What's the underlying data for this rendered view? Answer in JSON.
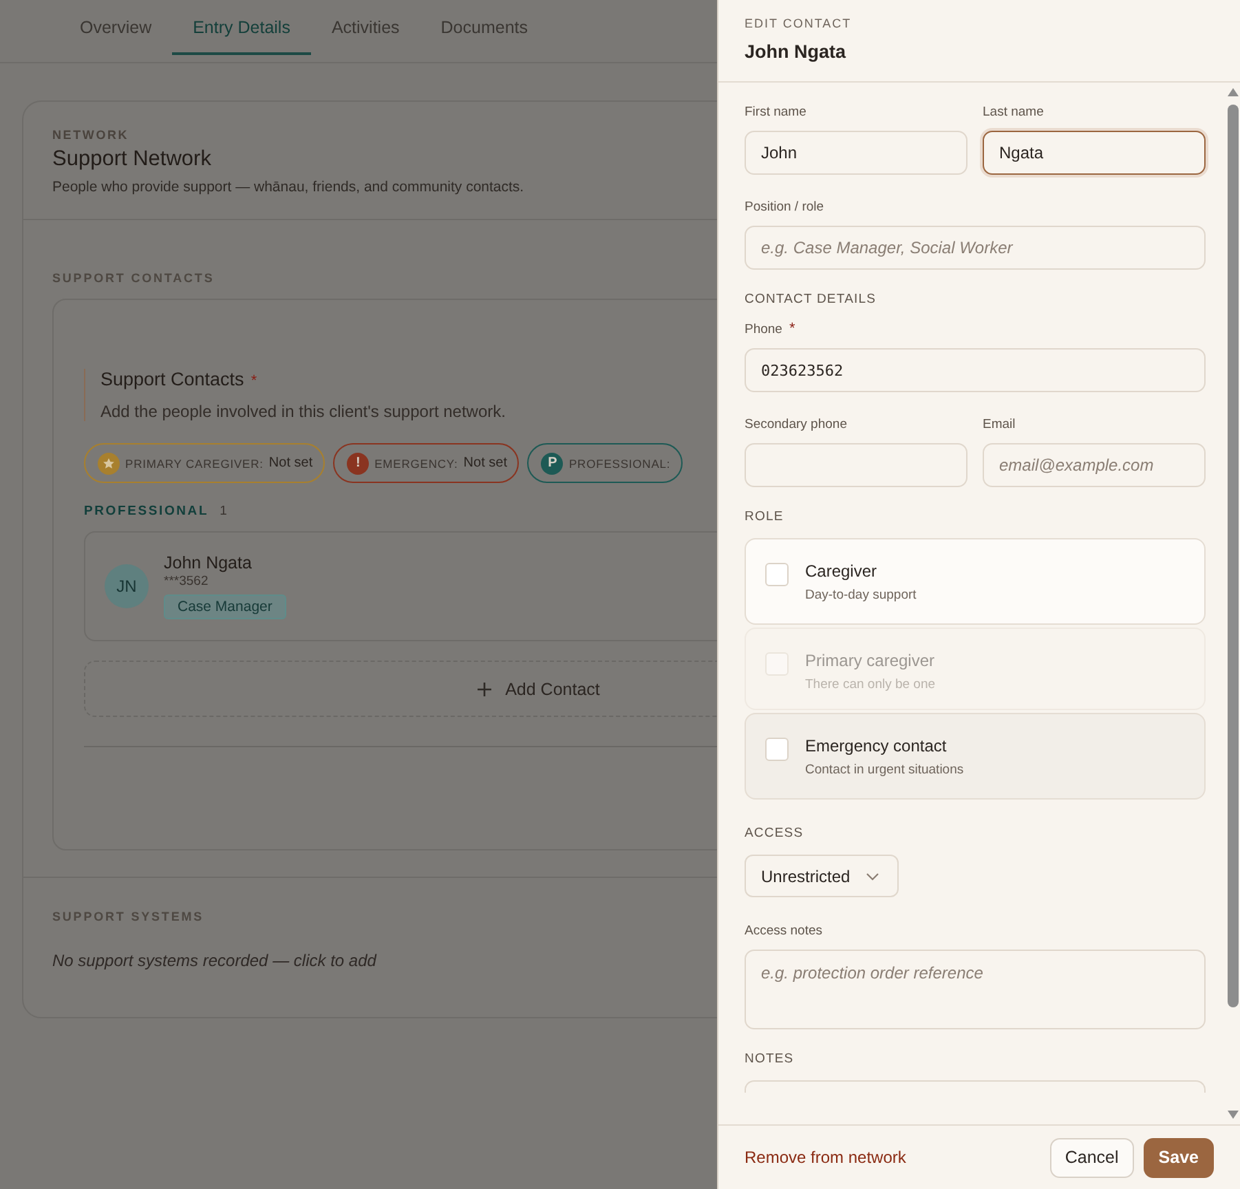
{
  "tabs": [
    {
      "label": "Overview",
      "selected": false
    },
    {
      "label": "Entry Details",
      "selected": true
    },
    {
      "label": "Activities",
      "selected": false
    },
    {
      "label": "Documents",
      "selected": false
    }
  ],
  "network": {
    "eyebrow": "NETWORK",
    "title": "Support Network",
    "description": "People who provide support — whānau, friends, and community contacts."
  },
  "support_contacts": {
    "section_label": "SUPPORT CONTACTS",
    "title": "Support Contacts",
    "required_mark": "*",
    "description": "Add the people involved in this client's support network.",
    "summary_chips": [
      {
        "kind": "star",
        "label": "PRIMARY CAREGIVER:",
        "value": "Not set",
        "color": "#a8802e"
      },
      {
        "kind": "letter",
        "icon_text": "!",
        "label": "EMERGENCY:",
        "value": "Not set",
        "color": "#8a3420"
      },
      {
        "kind": "letter",
        "icon_text": "P",
        "label": "PROFESSIONAL:",
        "color": "#1d5a55"
      }
    ],
    "groups": [
      {
        "title": "PROFESSIONAL",
        "count": "1",
        "contacts": [
          {
            "initials": "JN",
            "name": "John Ngata",
            "phone": "***3562",
            "tags": [
              "Case Manager"
            ]
          }
        ]
      }
    ],
    "add_button": "Add Contact"
  },
  "support_systems": {
    "section_label": "SUPPORT SYSTEMS",
    "empty_text": "No support systems recorded — click to add"
  },
  "drawer": {
    "eyebrow": "EDIT CONTACT",
    "title": "John Ngata",
    "name_fields": [
      {
        "label": "First name",
        "value": "John",
        "focused": false
      },
      {
        "label": "Last name",
        "value": "Ngata",
        "focused": true
      }
    ],
    "position": {
      "label": "Position / role",
      "placeholder": "e.g. Case Manager, Social Worker"
    },
    "contact_details": {
      "heading": "CONTACT DETAILS",
      "phone": {
        "label": "Phone",
        "required_mark": "*",
        "value": "023623562"
      },
      "secondary_phone": {
        "label": "Secondary phone"
      },
      "email": {
        "label": "Email",
        "placeholder": "email@example.com"
      }
    },
    "role": {
      "heading": "ROLE",
      "options": [
        {
          "label": "Caregiver",
          "hint": "Day-to-day support",
          "checked": false,
          "disabled": false,
          "highlighted": false
        },
        {
          "label": "Primary caregiver",
          "hint": "There can only be one",
          "checked": false,
          "disabled": true,
          "highlighted": false
        },
        {
          "label": "Emergency contact",
          "hint": "Contact in urgent situations",
          "checked": false,
          "disabled": false,
          "highlighted": true
        }
      ]
    },
    "access": {
      "heading": "ACCESS",
      "value": "Unrestricted"
    },
    "access_notes": {
      "label": "Access notes",
      "placeholder": "e.g. protection order reference"
    },
    "notes": {
      "heading": "NOTES"
    },
    "footer": {
      "remove_link": "Remove from network",
      "cancel": "Cancel",
      "save": "Save"
    }
  }
}
